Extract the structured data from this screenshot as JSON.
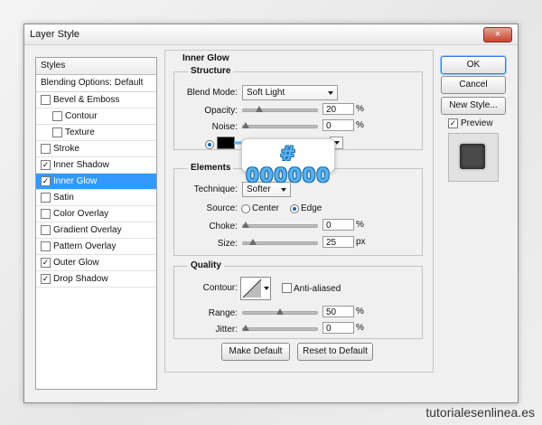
{
  "window": {
    "title": "Layer Style",
    "close_glyph": "×"
  },
  "styles_panel": {
    "header": "Styles",
    "blending_options": "Blending Options: Default",
    "items": [
      {
        "label": "Bevel & Emboss",
        "checked": false,
        "indent": false,
        "selected": false
      },
      {
        "label": "Contour",
        "checked": false,
        "indent": true,
        "selected": false
      },
      {
        "label": "Texture",
        "checked": false,
        "indent": true,
        "selected": false
      },
      {
        "label": "Stroke",
        "checked": false,
        "indent": false,
        "selected": false
      },
      {
        "label": "Inner Shadow",
        "checked": true,
        "indent": false,
        "selected": false
      },
      {
        "label": "Inner Glow",
        "checked": true,
        "indent": false,
        "selected": true
      },
      {
        "label": "Satin",
        "checked": false,
        "indent": false,
        "selected": false
      },
      {
        "label": "Color Overlay",
        "checked": false,
        "indent": false,
        "selected": false
      },
      {
        "label": "Gradient Overlay",
        "checked": false,
        "indent": false,
        "selected": false
      },
      {
        "label": "Pattern Overlay",
        "checked": false,
        "indent": false,
        "selected": false
      },
      {
        "label": "Outer Glow",
        "checked": true,
        "indent": false,
        "selected": false
      },
      {
        "label": "Drop Shadow",
        "checked": true,
        "indent": false,
        "selected": false
      }
    ]
  },
  "inner_glow": {
    "title": "Inner Glow",
    "structure": {
      "title": "Structure",
      "blend_mode_label": "Blend Mode:",
      "blend_mode_value": "Soft Light",
      "opacity_label": "Opacity:",
      "opacity_value": "20",
      "opacity_unit": "%",
      "opacity_fraction": 0.2,
      "noise_label": "Noise:",
      "noise_value": "0",
      "noise_unit": "%",
      "noise_fraction": 0.0,
      "glow_color": "#000000"
    },
    "elements": {
      "title": "Elements",
      "technique_label": "Technique:",
      "technique_value": "Softer",
      "source_label": "Source:",
      "source_center": "Center",
      "source_edge": "Edge",
      "choke_label": "Choke:",
      "choke_value": "0",
      "choke_unit": "%",
      "choke_fraction": 0.0,
      "size_label": "Size:",
      "size_value": "25",
      "size_unit": "px",
      "size_fraction": 0.1
    },
    "quality": {
      "title": "Quality",
      "contour_label": "Contour:",
      "anti_aliased_label": "Anti-aliased",
      "range_label": "Range:",
      "range_value": "50",
      "range_unit": "%",
      "range_fraction": 0.5,
      "jitter_label": "Jitter:",
      "jitter_value": "0",
      "jitter_unit": "%",
      "jitter_fraction": 0.0
    },
    "make_default": "Make Default",
    "reset_default": "Reset to Default"
  },
  "buttons": {
    "ok": "OK",
    "cancel": "Cancel",
    "new_style": "New Style...",
    "preview": "Preview"
  },
  "tooltip": {
    "text": "# 000000"
  },
  "watermark": "tutorialesenlinea.es",
  "colors": {
    "selection": "#3399ff",
    "tooltip_text": "#59b2ef",
    "close_button": "#c7442f"
  }
}
